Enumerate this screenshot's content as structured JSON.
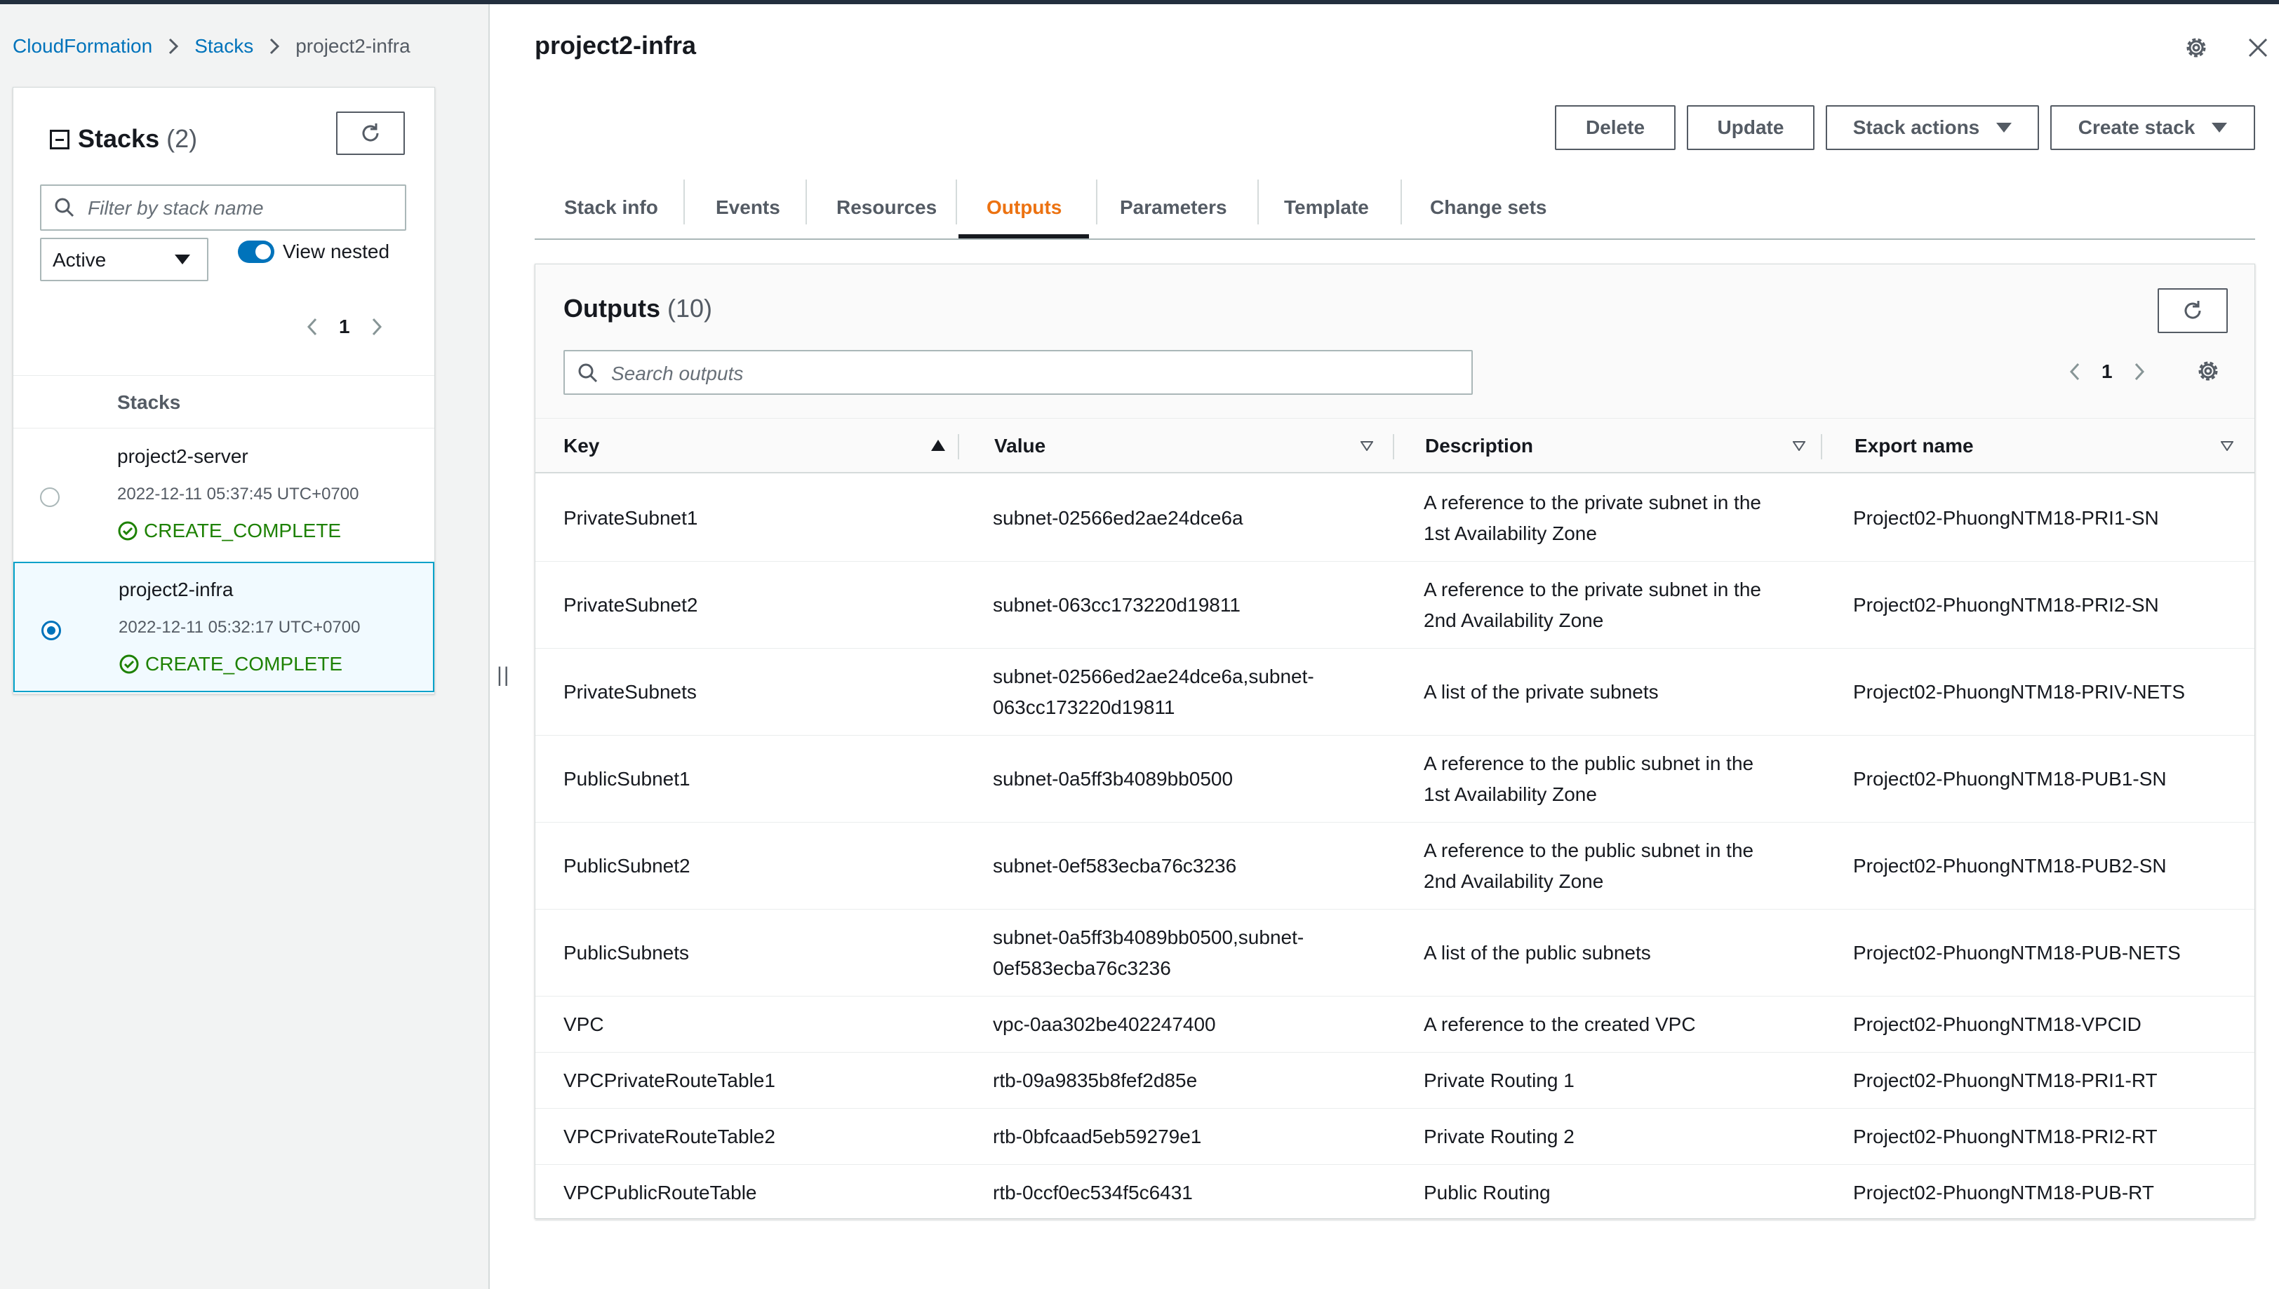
{
  "breadcrumb": {
    "items": [
      "CloudFormation",
      "Stacks"
    ],
    "current": "project2-infra"
  },
  "stacks_panel": {
    "title": "Stacks",
    "count": "(2)",
    "filter_placeholder": "Filter by stack name",
    "status_filter": "Active",
    "view_nested_label": "View nested",
    "view_nested_on": true,
    "page": "1",
    "column_header": "Stacks",
    "items": [
      {
        "name": "project2-server",
        "date": "2022-12-11 05:37:45 UTC+0700",
        "status": "CREATE_COMPLETE",
        "selected": false
      },
      {
        "name": "project2-infra",
        "date": "2022-12-11 05:32:17 UTC+0700",
        "status": "CREATE_COMPLETE",
        "selected": true
      }
    ]
  },
  "main": {
    "title": "project2-infra",
    "actions": {
      "delete": "Delete",
      "update": "Update",
      "stack_actions": "Stack actions",
      "create_stack": "Create stack"
    },
    "tabs": [
      {
        "label": "Stack info",
        "active": false
      },
      {
        "label": "Events",
        "active": false
      },
      {
        "label": "Resources",
        "active": false
      },
      {
        "label": "Outputs",
        "active": true
      },
      {
        "label": "Parameters",
        "active": false
      },
      {
        "label": "Template",
        "active": false
      },
      {
        "label": "Change sets",
        "active": false
      }
    ]
  },
  "outputs": {
    "title": "Outputs",
    "count": "(10)",
    "search_placeholder": "Search outputs",
    "page": "1",
    "columns": {
      "key": "Key",
      "value": "Value",
      "description": "Description",
      "export_name": "Export name"
    },
    "rows": [
      {
        "key": "PrivateSubnet1",
        "value": [
          "subnet-02566ed2ae24dce6a"
        ],
        "description": [
          "A reference to the private subnet in the",
          "1st Availability Zone"
        ],
        "export_name": "Project02-PhuongNTM18-PRI1-SN"
      },
      {
        "key": "PrivateSubnet2",
        "value": [
          "subnet-063cc173220d19811"
        ],
        "description": [
          "A reference to the private subnet in the",
          "2nd Availability Zone"
        ],
        "export_name": "Project02-PhuongNTM18-PRI2-SN"
      },
      {
        "key": "PrivateSubnets",
        "value": [
          "subnet-02566ed2ae24dce6a,subnet-",
          "063cc173220d19811"
        ],
        "description": [
          "A list of the private subnets"
        ],
        "export_name": "Project02-PhuongNTM18-PRIV-NETS"
      },
      {
        "key": "PublicSubnet1",
        "value": [
          "subnet-0a5ff3b4089bb0500"
        ],
        "description": [
          "A reference to the public subnet in the",
          "1st Availability Zone"
        ],
        "export_name": "Project02-PhuongNTM18-PUB1-SN"
      },
      {
        "key": "PublicSubnet2",
        "value": [
          "subnet-0ef583ecba76c3236"
        ],
        "description": [
          "A reference to the public subnet in the",
          "2nd Availability Zone"
        ],
        "export_name": "Project02-PhuongNTM18-PUB2-SN"
      },
      {
        "key": "PublicSubnets",
        "value": [
          "subnet-0a5ff3b4089bb0500,subnet-",
          "0ef583ecba76c3236"
        ],
        "description": [
          "A list of the public subnets"
        ],
        "export_name": "Project02-PhuongNTM18-PUB-NETS"
      },
      {
        "key": "VPC",
        "value": [
          "vpc-0aa302be402247400"
        ],
        "description": [
          "A reference to the created VPC"
        ],
        "export_name": "Project02-PhuongNTM18-VPCID"
      },
      {
        "key": "VPCPrivateRouteTable1",
        "value": [
          "rtb-09a9835b8fef2d85e"
        ],
        "description": [
          "Private Routing 1"
        ],
        "export_name": "Project02-PhuongNTM18-PRI1-RT"
      },
      {
        "key": "VPCPrivateRouteTable2",
        "value": [
          "rtb-0bfcaad5eb59279e1"
        ],
        "description": [
          "Private Routing 2"
        ],
        "export_name": "Project02-PhuongNTM18-PRI2-RT"
      },
      {
        "key": "VPCPublicRouteTable",
        "value": [
          "rtb-0ccf0ec534f5c6431"
        ],
        "description": [
          "Public Routing"
        ],
        "export_name": "Project02-PhuongNTM18-PUB-RT"
      }
    ]
  },
  "colors": {
    "link": "#0073bb",
    "active_tab": "#ec7211",
    "success": "#1d8102",
    "selected_bg": "#f1faff",
    "selected_border": "#00a1c9"
  },
  "icons": [
    "collapse-icon",
    "refresh-icon",
    "search-icon",
    "chevron-left-icon",
    "chevron-right-icon",
    "settings-gear-icon",
    "close-icon",
    "success-check-icon",
    "caret-down-icon",
    "sort-ascending-icon",
    "sort-filter-icon",
    "drag-handle-icon"
  ]
}
